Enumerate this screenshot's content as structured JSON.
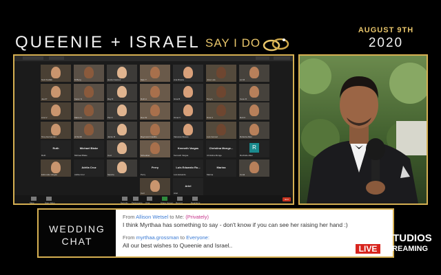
{
  "header": {
    "couple": "QUEENIE + ISRAEL",
    "tagline": "SAY I DO",
    "date_month": "AUGUST 9TH",
    "date_year": "2020"
  },
  "zoom": {
    "participants": [
      {
        "name": "Suzi Kudlak"
      },
      {
        "name": "M Berg"
      },
      {
        "name": "Hector Gomez"
      },
      {
        "name": "Sam T"
      },
      {
        "name": "Ana Rivera"
      },
      {
        "name": "Jose Luis"
      },
      {
        "name": "Liz M"
      },
      {
        "name": "Joel P"
      },
      {
        "name": "Karen S"
      },
      {
        "name": "Ray D"
      },
      {
        "name": "Ruth A"
      },
      {
        "name": "Gina B"
      },
      {
        "name": "Tony L"
      },
      {
        "name": "Cece R"
      },
      {
        "name": "Lina V"
      },
      {
        "name": "Mario G"
      },
      {
        "name": "Pat O"
      },
      {
        "name": "Dee W"
      },
      {
        "name": "Omar F"
      },
      {
        "name": "Nina C"
      },
      {
        "name": "Rob K"
      },
      {
        "name": "Tony Hernandez"
      },
      {
        "name": "Al Smith"
      },
      {
        "name": "Jamie R"
      },
      {
        "name": "Raymond Castillo"
      },
      {
        "name": "Vanessa Nieves"
      },
      {
        "name": "Luis Gomez"
      },
      {
        "name": "Roberta Allen"
      },
      {
        "name": "Ruth",
        "label": "Ruth"
      },
      {
        "name": "Michael Blake",
        "label": "Michael Blake"
      },
      {
        "name": "Ceci"
      },
      {
        "name": "Scheduler"
      },
      {
        "name": "Kenneth Vargas",
        "label": "Kenneth Vargas"
      },
      {
        "name": "Christina Monge",
        "label": "Christina  Monge..."
      },
      {
        "name": "Rochelle Allen",
        "label": "R"
      },
      {
        "name": "Edmundo Vargas"
      },
      {
        "name": "Adrila Cruz",
        "label": "Adrila Cruz"
      },
      {
        "name": "Sandra"
      },
      {
        "name": "Perry",
        "label": "Perry"
      },
      {
        "name": "Luis Eduardo",
        "label": "Luis Eduardo Ru..."
      },
      {
        "name": "Marina",
        "label": "Marina"
      },
      {
        "name": "Coral"
      },
      {
        "name": "Carl"
      },
      {
        "name": "Ariel",
        "label": "Ariel"
      }
    ],
    "end_label": "End",
    "toolbar": [
      "Mute",
      "Stop Video",
      "Security",
      "Participants",
      "Chat",
      "Share Screen",
      "Record",
      "Reactions"
    ]
  },
  "chat": {
    "label_line1": "WEDDING",
    "label_line2": "CHAT",
    "messages": [
      {
        "from_prefix": "From",
        "from": "Allison Wetsel",
        "to_prefix": "to",
        "to": "Me:",
        "privacy": "(Privately)",
        "text": "I think Myrthaa has something to say - don't know if you can see her raising her hand :)"
      },
      {
        "from_prefix": "From",
        "from": "myrthaa.grossman",
        "to_prefix": "to",
        "to": "Everyone:",
        "privacy": "",
        "text": "All our best wishes to Queenie and Israel.."
      }
    ]
  },
  "brand": {
    "name": "SWIFT STUDIOS",
    "live": "LIVE",
    "streaming": "STREAMING"
  },
  "colors": {
    "gold": "#d6b052",
    "live_red": "#d8251e",
    "link_blue": "#3b7bd4",
    "private_pink": "#c6348a"
  }
}
